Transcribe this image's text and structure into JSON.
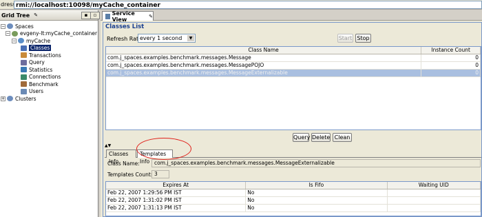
{
  "address": {
    "label": "dress:",
    "value": "rmi://localhost:10098/myCache_container"
  },
  "grid_tree": {
    "title": "Grid Tree",
    "pin_icon": "pin-icon",
    "nodes": [
      {
        "label": "Spaces",
        "depth": 0
      },
      {
        "label": "evgeny-lt:myCache_container",
        "depth": 1
      },
      {
        "label": "myCache",
        "depth": 2
      },
      {
        "label": "Classes",
        "depth": 3,
        "selected": true
      },
      {
        "label": "Transactions",
        "depth": 3
      },
      {
        "label": "Query",
        "depth": 3
      },
      {
        "label": "Statistics",
        "depth": 3
      },
      {
        "label": "Connections",
        "depth": 3
      },
      {
        "label": "Benchmark",
        "depth": 3
      },
      {
        "label": "Users",
        "depth": 3
      },
      {
        "label": "Clusters",
        "depth": 0
      }
    ]
  },
  "service_view": {
    "tab_label": "Service View",
    "classes_list": {
      "title": "Classes List",
      "refresh_label": "Refresh Rate:",
      "refresh_value": "every 1 second",
      "start_label": "Start",
      "stop_label": "Stop",
      "columns": [
        "Class Name",
        "Instance Count"
      ],
      "rows": [
        {
          "class_name": "com.j_spaces.examples.benchmark.messages.Message",
          "count": "0"
        },
        {
          "class_name": "com.j_spaces.examples.benchmark.messages.MessagePOJO",
          "count": "0"
        },
        {
          "class_name": "com.j_spaces.examples.benchmark.messages.MessageExternalizable",
          "count": "0"
        }
      ],
      "query_label": "Query",
      "delete_label": "Delete",
      "clean_label": "Clean"
    },
    "splitter_glyph": "▲▼",
    "tabs": [
      "Classes Info",
      "Templates Info"
    ],
    "active_tab": "Templates Info",
    "class_name_label": "Class Name:",
    "class_name_value": "com.j_spaces.examples.benchmark.messages.MessageExternalizable",
    "templates_count_label": "Templates Count:",
    "templates_count_value": "3",
    "templates_columns": [
      "Expires At",
      "Is Fifo",
      "Waiting UID"
    ],
    "templates_rows": [
      {
        "expires": "Feb 22, 2007 1:29:56 PM IST",
        "fifo": "No",
        "uid": ""
      },
      {
        "expires": "Feb 22, 2007 1:31:02 PM IST",
        "fifo": "No",
        "uid": ""
      },
      {
        "expires": "Feb 22, 2007 1:31:13 PM IST",
        "fifo": "No",
        "uid": ""
      }
    ]
  },
  "colors": {
    "selection": "#0a246a",
    "highlight_oval": "#e0201a",
    "section_title": "#1a3f8f"
  }
}
